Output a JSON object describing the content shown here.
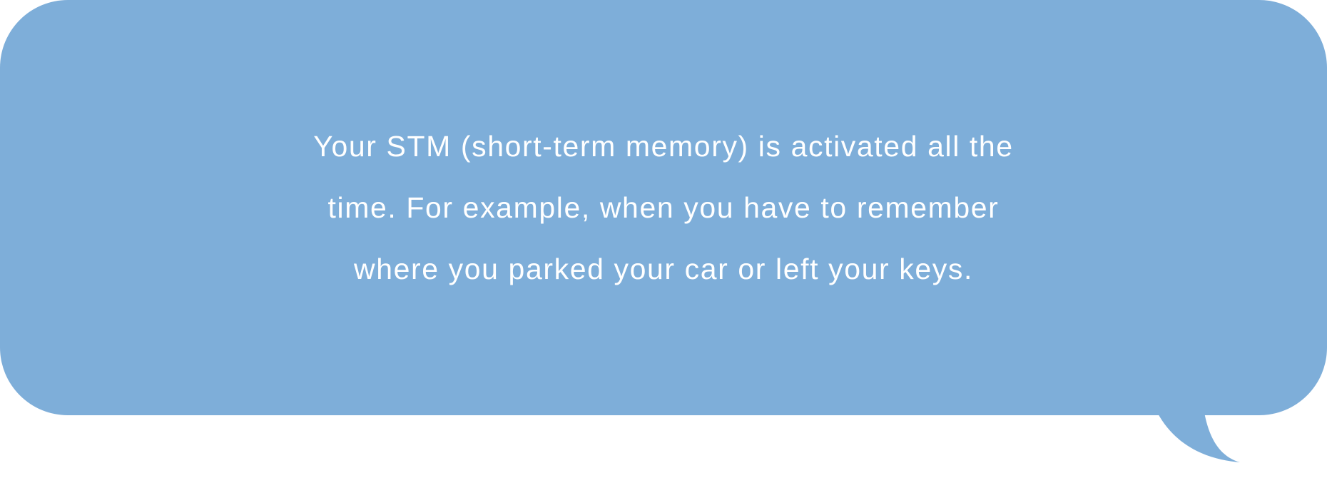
{
  "bubble": {
    "color": "#7eaed9",
    "lines": [
      "Your STM (short-term memory) is activated all the",
      "time. For example, when you have to remember",
      "where you parked your car or left your keys."
    ]
  }
}
